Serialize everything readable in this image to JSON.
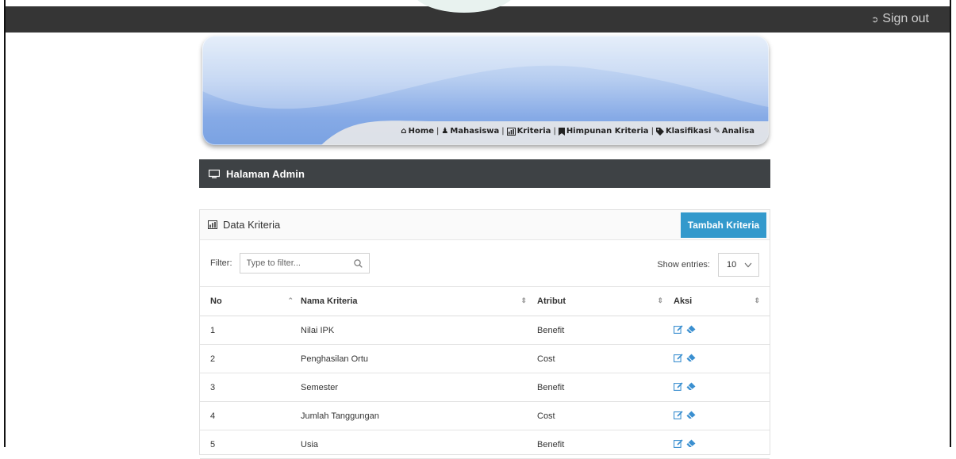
{
  "topbar": {
    "signout_label": "Sign out",
    "signout_icon": "sign-out-icon"
  },
  "banner": {
    "nav": [
      {
        "label": "Home",
        "icon": "home-icon"
      },
      {
        "label": "Mahasiswa",
        "icon": "users-icon"
      },
      {
        "label": "Kriteria",
        "icon": "bar-chart-icon"
      },
      {
        "label": "Himpunan Kriteria",
        "icon": "bookmark-icon"
      },
      {
        "label": "Klasifikasi",
        "icon": "tag-icon"
      },
      {
        "label": "Analisa",
        "icon": "pencil-icon"
      }
    ],
    "separator": "|"
  },
  "admin": {
    "title": "Halaman Admin"
  },
  "panel": {
    "title": "Data Kriteria",
    "add_button": "Tambah Kriteria",
    "filter_label": "Filter:",
    "filter_placeholder": "Type to filter...",
    "entries_label": "Show entries:",
    "entries_value": "10",
    "columns": [
      "No",
      "Nama Kriteria",
      "Atribut",
      "Aksi"
    ],
    "rows": [
      {
        "no": "1",
        "nama": "Nilai IPK",
        "atribut": "Benefit"
      },
      {
        "no": "2",
        "nama": "Penghasilan Ortu",
        "atribut": "Cost"
      },
      {
        "no": "3",
        "nama": "Semester",
        "atribut": "Benefit"
      },
      {
        "no": "4",
        "nama": "Jumlah Tanggungan",
        "atribut": "Cost"
      },
      {
        "no": "5",
        "nama": "Usia",
        "atribut": "Benefit"
      }
    ]
  },
  "colors": {
    "accent": "#3399cc",
    "topbar": "#353535",
    "admin_bar": "#3e4245"
  }
}
